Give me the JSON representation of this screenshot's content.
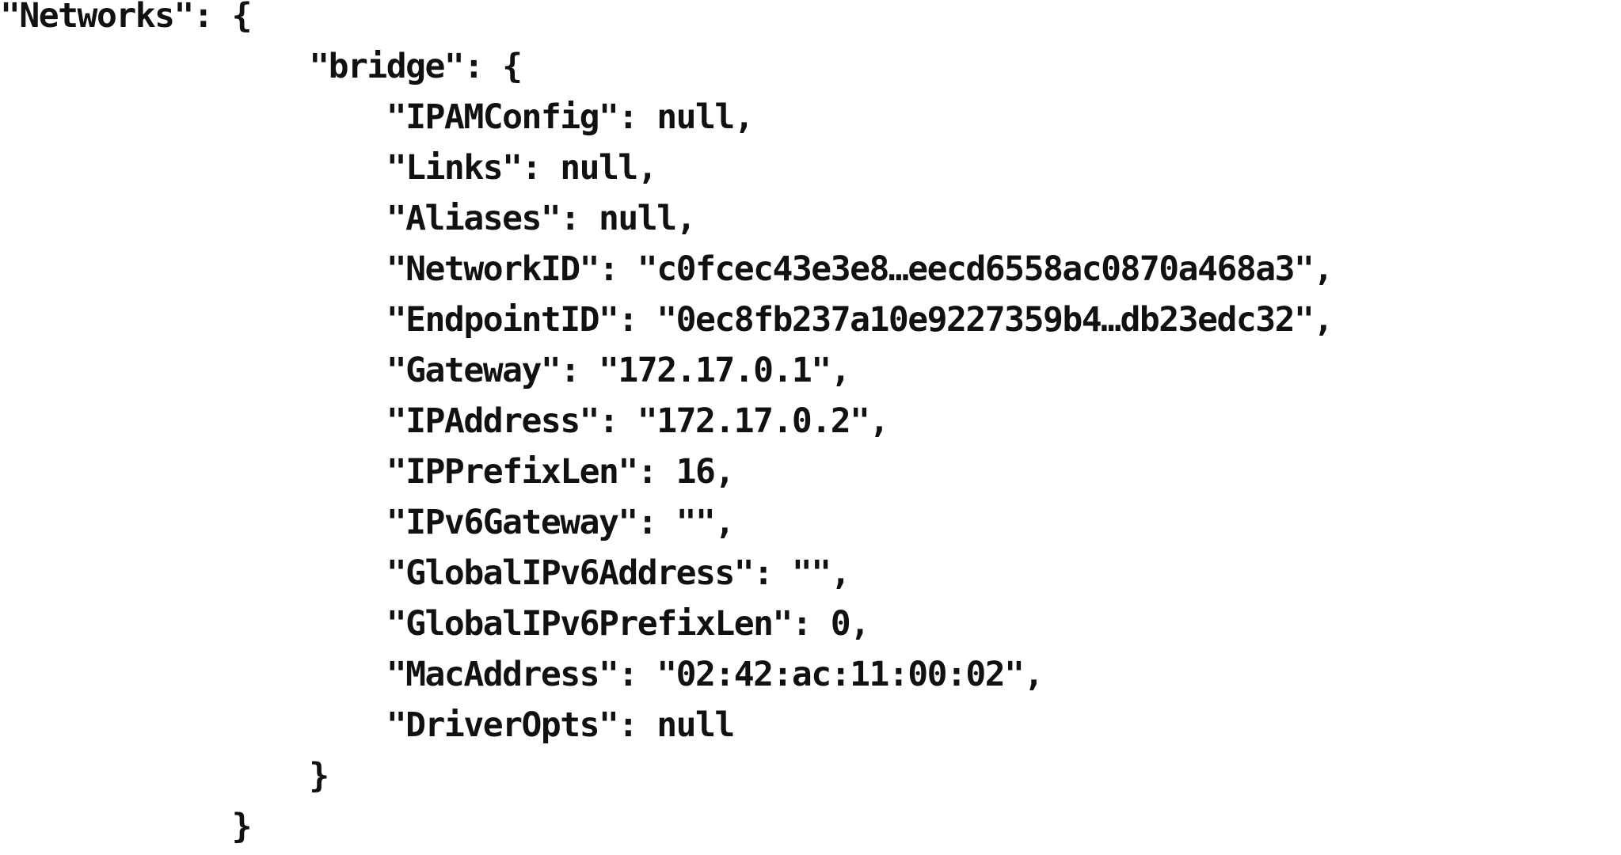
{
  "document": {
    "lines": [
      "\"Networks\": {",
      "                \"bridge\": {",
      "                    \"IPAMConfig\": null,",
      "                    \"Links\": null,",
      "                    \"Aliases\": null,",
      "                    \"NetworkID\": \"c0fcec43e3e8…eecd6558ac0870a468a3\",",
      "                    \"EndpointID\": \"0ec8fb237a10e9227359b4…db23edc32\",",
      "                    \"Gateway\": \"172.17.0.1\",",
      "                    \"IPAddress\": \"172.17.0.2\",",
      "                    \"IPPrefixLen\": 16,",
      "                    \"IPv6Gateway\": \"\",",
      "                    \"GlobalIPv6Address\": \"\",",
      "                    \"GlobalIPv6PrefixLen\": 0,",
      "                    \"MacAddress\": \"02:42:ac:11:00:02\",",
      "                    \"DriverOpts\": null",
      "                }",
      "            }"
    ]
  }
}
